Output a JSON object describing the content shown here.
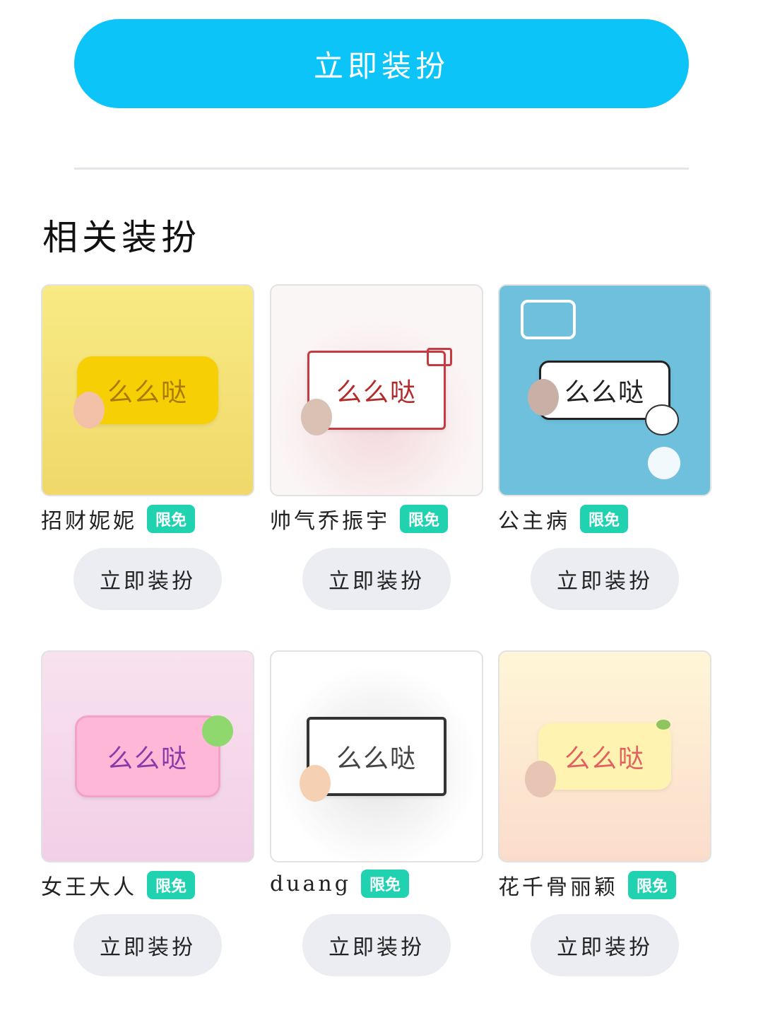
{
  "primary_action_label": "立即装扮",
  "section_title": "相关装扮",
  "items": [
    {
      "name": "招财妮妮",
      "badge": "限免",
      "preview_text": "么么哒",
      "button": "立即装扮",
      "theme": {
        "bg": "#f6e57a",
        "bubble": "#f7cf05",
        "text": "#a77a00"
      }
    },
    {
      "name": "帅气乔振宇",
      "badge": "限免",
      "preview_text": "么么哒",
      "button": "立即装扮",
      "theme": {
        "bg": "#f7eff0",
        "bubble": "#ffffff",
        "text": "#b22a2a"
      }
    },
    {
      "name": "公主病",
      "badge": "限免",
      "preview_text": "么么哒",
      "button": "立即装扮",
      "theme": {
        "bg": "#6ec0dd",
        "bubble": "#ffffff",
        "text": "#222222"
      }
    },
    {
      "name": "女王大人",
      "badge": "限免",
      "preview_text": "么么哒",
      "button": "立即装扮",
      "theme": {
        "bg": "#f5d6e9",
        "bubble": "#ffb7d8",
        "text": "#8a3aa6"
      }
    },
    {
      "name": "duang",
      "badge": "限免",
      "preview_text": "么么哒",
      "button": "立即装扮",
      "theme": {
        "bg": "#f3f3f3",
        "bubble": "#ffffff",
        "text": "#444444"
      }
    },
    {
      "name": "花千骨丽颖",
      "badge": "限免",
      "preview_text": "么么哒",
      "button": "立即装扮",
      "theme": {
        "bg": "#fbe7c6",
        "bubble": "#fff3b2",
        "text": "#e06160"
      }
    }
  ]
}
